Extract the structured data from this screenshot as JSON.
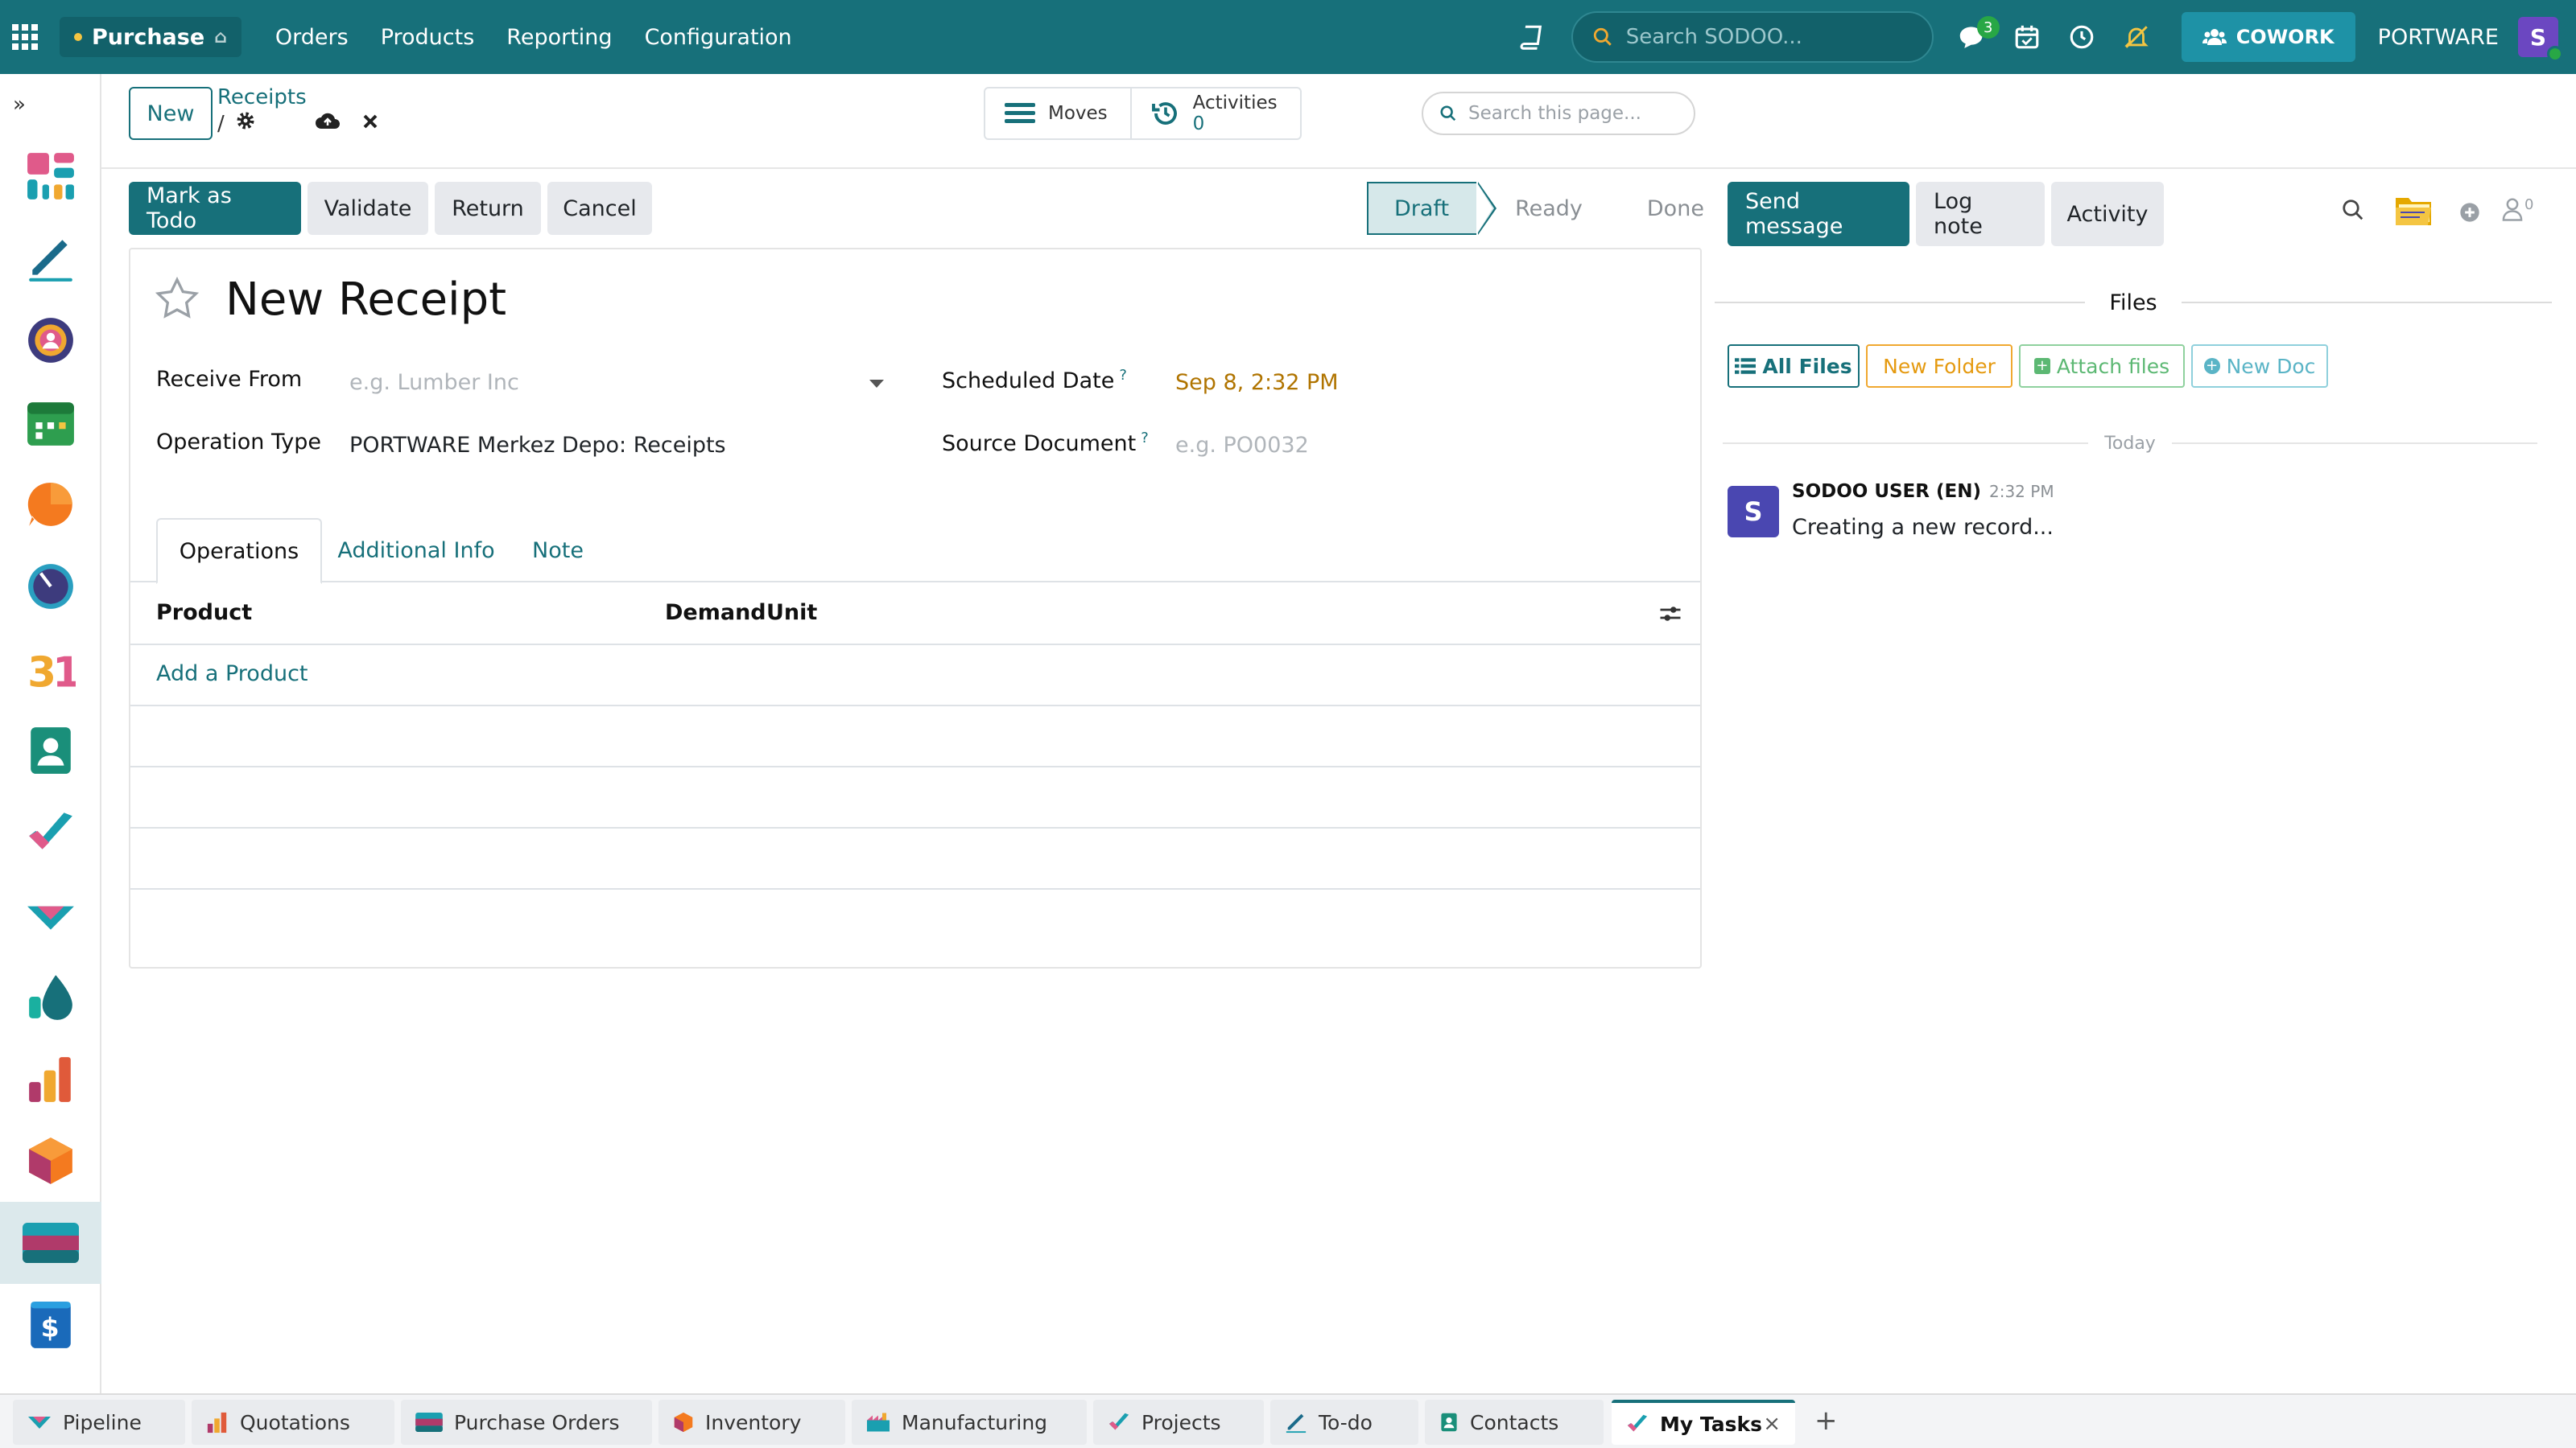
{
  "navbar": {
    "app_name": "Purchase",
    "menu": [
      "Orders",
      "Products",
      "Reporting",
      "Configuration"
    ],
    "search_placeholder": "Search SODOO...",
    "messages_badge": "3",
    "cowork_label": "COWORK",
    "company": "PORTWARE",
    "user_initial": "S",
    "accent": "#17707a"
  },
  "control_panel": {
    "new_label": "New",
    "breadcrumb": "Receipts",
    "breadcrumb_sep": "/",
    "moves_label": "Moves",
    "activities_label": "Activities",
    "activities_count": "0",
    "search_placeholder": "Search this page..."
  },
  "statusbar": {
    "buttons": [
      "Mark as Todo",
      "Validate",
      "Return",
      "Cancel"
    ],
    "stages": [
      "Draft",
      "Ready",
      "Done"
    ],
    "current_stage": "Draft"
  },
  "form": {
    "title": "New Receipt",
    "receive_from_label": "Receive From",
    "receive_from_placeholder": "e.g. Lumber Inc",
    "operation_type_label": "Operation Type",
    "operation_type_value": "PORTWARE Merkez Depo: Receipts",
    "scheduled_date_label": "Scheduled Date",
    "scheduled_date_value": "Sep 8, 2:32 PM",
    "source_document_label": "Source Document",
    "source_document_placeholder": "e.g. PO0032",
    "help_mark": "?",
    "tabs": [
      "Operations",
      "Additional Info",
      "Note"
    ],
    "columns": [
      "Product",
      "Demand",
      "Unit"
    ],
    "add_line": "Add a Product"
  },
  "chatter": {
    "send_message": "Send message",
    "log_note": "Log note",
    "activity": "Activity",
    "followers_count": "0",
    "files_title": "Files",
    "file_buttons": [
      "All Files",
      "New Folder",
      "Attach files",
      "New Doc"
    ],
    "date_separator": "Today",
    "message": {
      "author": "SODOO USER (EN)",
      "time": "2:32 PM",
      "body": "Creating a new record...",
      "initial": "S"
    }
  },
  "bottom_tabs": [
    "Pipeline",
    "Quotations",
    "Purchase Orders",
    "Inventory",
    "Manufacturing",
    "Projects",
    "To-do",
    "Contacts",
    "My Tasks"
  ],
  "active_bottom_tab": "My Tasks"
}
